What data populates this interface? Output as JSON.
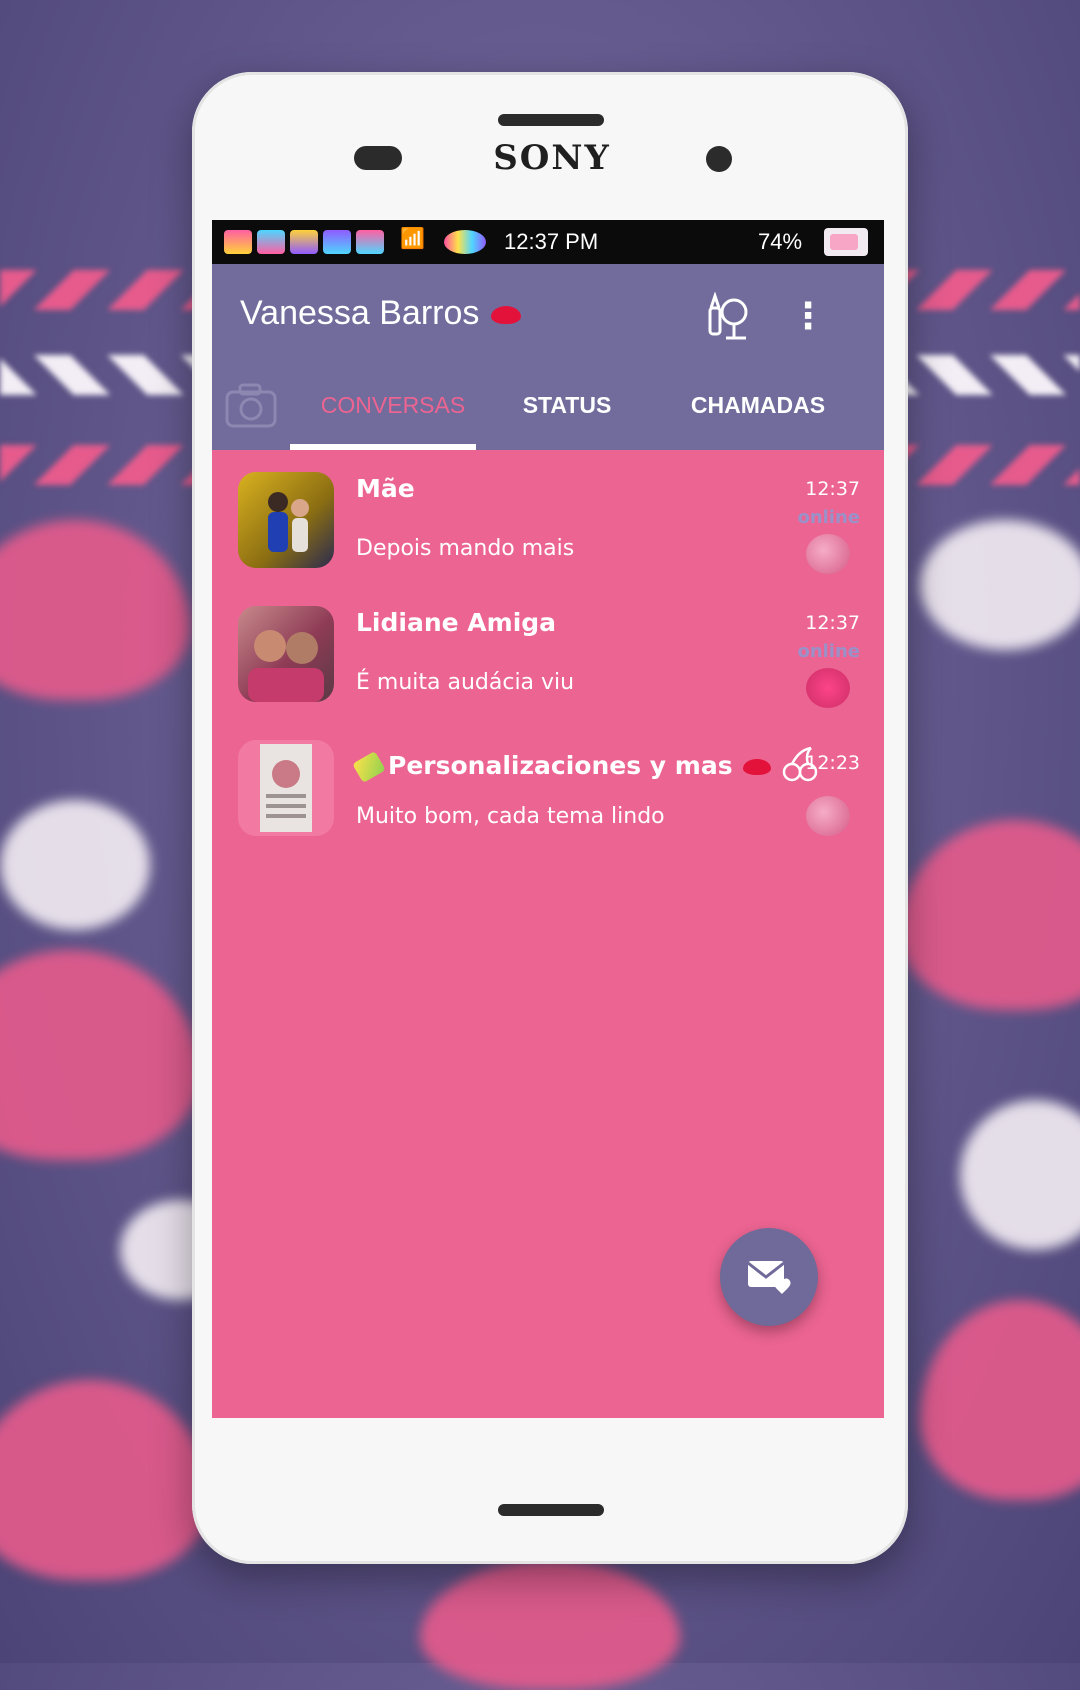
{
  "device": {
    "brand": "SONY"
  },
  "status_bar": {
    "time": "12:37 PM",
    "battery_percent": "74%",
    "app_icons": [
      "app-icon-1",
      "app-icon-2",
      "app-icon-3",
      "app-icon-4",
      "app-icon-5"
    ],
    "signal_icon": "signal-wifi-icon"
  },
  "app_bar": {
    "title": "Vanessa Barros",
    "title_icon": "lips-icon",
    "actions": [
      "search-lipstick-icon",
      "more-vert-icon"
    ]
  },
  "tabs": [
    {
      "label": "CONVERSAS",
      "selected": true
    },
    {
      "label": "STATUS",
      "selected": false
    },
    {
      "label": "CHAMADAS",
      "selected": false
    }
  ],
  "chats": [
    {
      "name": "Mãe",
      "message": "Depois mando mais",
      "time": "12:37",
      "presence": "online"
    },
    {
      "name": "Lidiane Amiga",
      "message": "É muita audácia viu",
      "time": "12:37",
      "presence": "online"
    },
    {
      "name": "Personalizaciones y mas",
      "message": "Muito bom, cada tema lindo",
      "time": "12:23",
      "presence": ""
    }
  ],
  "fab": {
    "icon": "mail-heart-icon"
  },
  "colors": {
    "chat_background": "#ec6492",
    "app_bar": "#716c9b",
    "status_bar": "#0b0b0b",
    "selected_tab": "#ec6492",
    "online_text": "#9a91c9",
    "background": "#5e5488"
  }
}
